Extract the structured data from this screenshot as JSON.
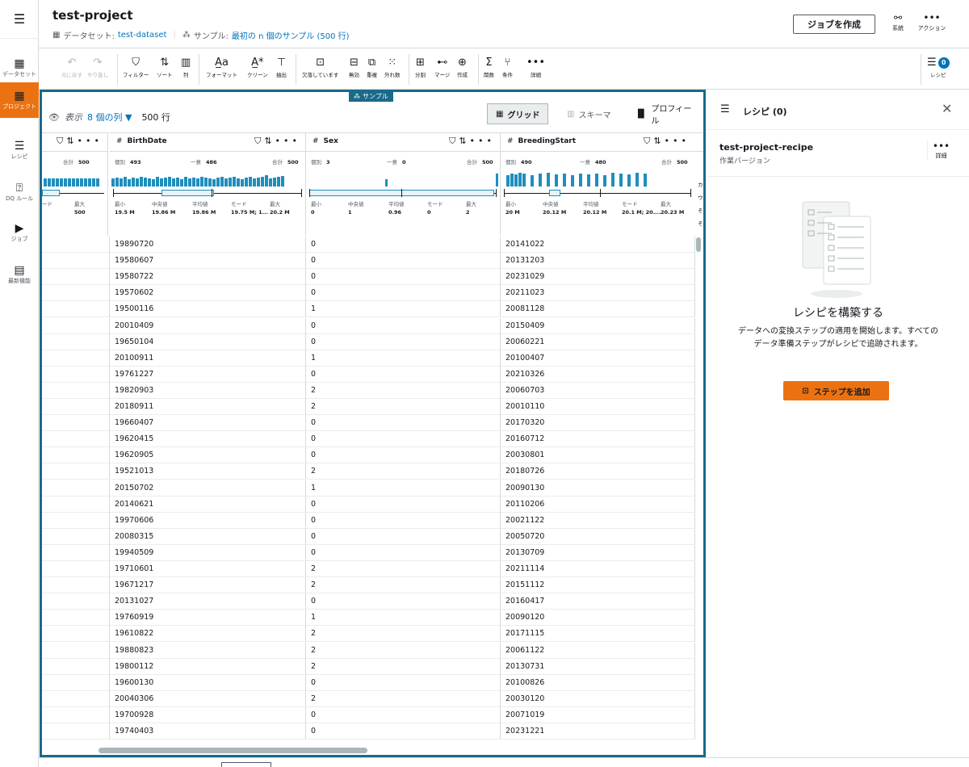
{
  "nav": {
    "menu_icon": "hamburger-icon",
    "items": [
      {
        "label": "データセット",
        "icon": "table-icon"
      },
      {
        "label": "プロジェクト",
        "icon": "grid-icon",
        "active": true
      },
      {
        "label": "レシピ",
        "icon": "recipe-icon"
      },
      {
        "label": "DQ ルール",
        "icon": "dq-rule-icon"
      },
      {
        "label": "ジョブ",
        "icon": "play-icon"
      },
      {
        "label": "最新機能",
        "icon": "news-icon"
      }
    ]
  },
  "header": {
    "title": "test-project",
    "dataset_label": "データセット:",
    "dataset_name": "test-dataset",
    "sample_label": "サンプル:",
    "sample_value": "最初の n 個のサンプル (500 行)",
    "create_job": "ジョブを作成",
    "lineage_label": "系統",
    "actions_label": "アクション"
  },
  "toolbar": {
    "undo": "元に戻す",
    "redo": "やり直し",
    "filter": "フィルター",
    "sort": "ソート",
    "column": "列",
    "format": "フォーマット",
    "clean": "クリーン",
    "extract": "抽出",
    "missing": "欠落しています",
    "invalid": "無効",
    "duplicate": "重複",
    "outlier": "外れ数",
    "split": "分割",
    "merge": "マージ",
    "create": "作成",
    "function": "関数",
    "condition": "条件",
    "details": "詳細",
    "recipe": "レシピ",
    "recipe_count": "0"
  },
  "grid": {
    "sample_badge": "サンプル",
    "view_label": "表示",
    "columns_label": "8 個の列",
    "rows_label": "500 行",
    "tabs": {
      "grid": "グリッド",
      "schema": "スキーマ",
      "profile": "プロフィール"
    },
    "stat_labels": {
      "distinct": "個別",
      "unique": "一意",
      "total": "合計",
      "min": "最小",
      "median": "中央値",
      "mean": "平均値",
      "mode": "モード",
      "max": "最大"
    },
    "partial_col": {
      "mode_label": "ード",
      "max_label": "最大",
      "max_value": "500",
      "total_label": "合計",
      "total_value": "500"
    },
    "columns": [
      {
        "name": "BirthDate",
        "distinct": "493",
        "unique": "486",
        "total": "500",
        "min": "19.5 M",
        "median": "19.86 M",
        "mean": "19.86 M",
        "mode": "19.75 M; 1...",
        "max": "20.2 M"
      },
      {
        "name": "Sex",
        "distinct": "3",
        "unique": "0",
        "total": "500",
        "min": "0",
        "median": "1",
        "mean": "0.96",
        "mode": "0",
        "max": "2"
      },
      {
        "name": "BreedingStart",
        "distinct": "490",
        "unique": "480",
        "total": "500",
        "min": "20 M",
        "median": "20.12 M",
        "mean": "20.12 M",
        "mode": "20.1 M; 20....",
        "max": "20.23 M"
      }
    ],
    "right_partial_labels": [
      "カ",
      "ウ",
      "そ",
      "そ"
    ],
    "rows": [
      [
        "19890720",
        "0",
        "20141022"
      ],
      [
        "19580607",
        "0",
        "20131203"
      ],
      [
        "19580722",
        "0",
        "20231029"
      ],
      [
        "19570602",
        "0",
        "20211023"
      ],
      [
        "19500116",
        "1",
        "20081128"
      ],
      [
        "20010409",
        "0",
        "20150409"
      ],
      [
        "19650104",
        "0",
        "20060221"
      ],
      [
        "20100911",
        "1",
        "20100407"
      ],
      [
        "19761227",
        "0",
        "20210326"
      ],
      [
        "19820903",
        "2",
        "20060703"
      ],
      [
        "20180911",
        "2",
        "20010110"
      ],
      [
        "19660407",
        "0",
        "20170320"
      ],
      [
        "19620415",
        "0",
        "20160712"
      ],
      [
        "19620905",
        "0",
        "20030801"
      ],
      [
        "19521013",
        "2",
        "20180726"
      ],
      [
        "20150702",
        "1",
        "20090130"
      ],
      [
        "20140621",
        "0",
        "20110206"
      ],
      [
        "19970606",
        "0",
        "20021122"
      ],
      [
        "20080315",
        "0",
        "20050720"
      ],
      [
        "19940509",
        "0",
        "20130709"
      ],
      [
        "19710601",
        "2",
        "20211114"
      ],
      [
        "19671217",
        "2",
        "20151112"
      ],
      [
        "20131027",
        "0",
        "20160417"
      ],
      [
        "19760919",
        "1",
        "20090120"
      ],
      [
        "19610822",
        "2",
        "20171115"
      ],
      [
        "19880823",
        "2",
        "20061122"
      ],
      [
        "19800112",
        "2",
        "20130731"
      ],
      [
        "19600130",
        "0",
        "20100826"
      ],
      [
        "20040306",
        "2",
        "20030120"
      ],
      [
        "19700928",
        "0",
        "20071019"
      ],
      [
        "19740403",
        "0",
        "20231221"
      ]
    ]
  },
  "recipe": {
    "title": "レシピ (0)",
    "name": "test-project-recipe",
    "version": "作業バージョン",
    "more_label": "詳細",
    "build_title": "レシピを構築する",
    "description": "データへの変換ステップの適用を開始します。すべてのデータ準備ステップがレシピで追跡されます。",
    "add_step": "ステップを追加"
  },
  "colors": {
    "accent": "#ec7211",
    "grid_border": "#1a6a8a",
    "link": "#0073bb",
    "hist": "#1f8ebd"
  }
}
